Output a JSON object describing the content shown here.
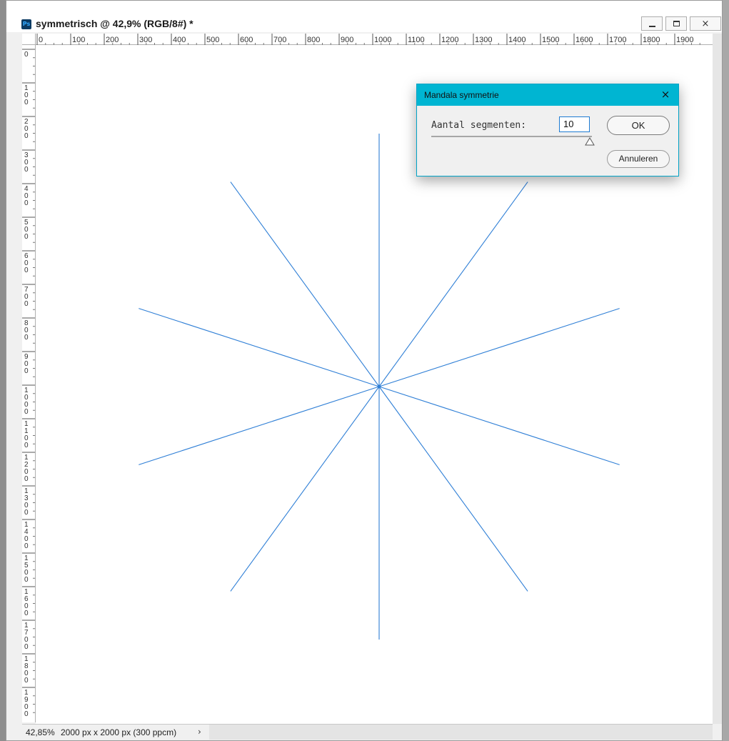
{
  "window": {
    "title": "symmetrisch @ 42,9% (RGB/8#) *",
    "app_icon_text": "Ps",
    "minimize_label": "–",
    "maximize_label": "□",
    "close_label": "×"
  },
  "rulers": {
    "horizontal_ticks": [
      "0",
      "100",
      "200",
      "300",
      "400",
      "500",
      "600",
      "700",
      "800",
      "900",
      "1000",
      "1100",
      "1200",
      "1300",
      "1400",
      "1500",
      "1600",
      "1700",
      "1800",
      "1900"
    ],
    "vertical_ticks": [
      "0",
      "100",
      "200",
      "300",
      "400",
      "500",
      "600",
      "700",
      "800",
      "900",
      "1000",
      "1100",
      "1200",
      "1300",
      "1400",
      "1500",
      "1600",
      "1700",
      "1800",
      "1900"
    ]
  },
  "canvas": {
    "guide_color": "#2f7fd6",
    "segments": 10
  },
  "dialog": {
    "title": "Mandala symmetrie",
    "close_label": "×",
    "segments_label": "Aantal segmenten:",
    "segments_value": "10",
    "ok_label": "OK",
    "cancel_label": "Annuleren",
    "accent_color": "#00b5d2"
  },
  "status": {
    "zoom": "42,85%",
    "doc_info": "2000 px x 2000 px (300 ppcm)",
    "arrow": "›"
  }
}
